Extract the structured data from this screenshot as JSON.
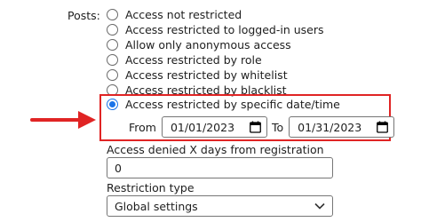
{
  "posts_label": "Posts:",
  "options": [
    "Access not restricted",
    "Access restricted to logged-in users",
    "Allow only anonymous access",
    "Access restricted by role",
    "Access restricted by whitelist",
    "Access restricted by blacklist"
  ],
  "selected_option": "Access restricted by specific date/time",
  "date_range": {
    "from_label": "From",
    "from_value": "01/01/2023",
    "to_label": "To",
    "to_value": "01/31/2023"
  },
  "days_field": {
    "label": "Access denied X days from registration",
    "value": "0"
  },
  "restriction_type": {
    "label": "Restriction type",
    "value": "Global settings"
  },
  "colors": {
    "highlight": "#e02424",
    "accent": "#1a73e8"
  },
  "icons": {
    "calendar": "calendar-icon",
    "dropdown": "chevron-down-icon",
    "pointer": "arrow-right-icon"
  }
}
